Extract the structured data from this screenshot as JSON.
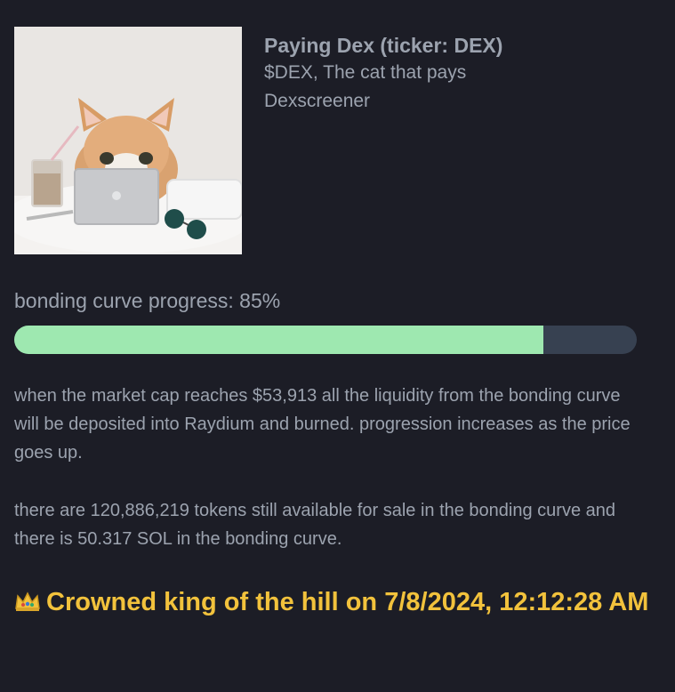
{
  "token": {
    "title": "Paying Dex (ticker: DEX)",
    "description": "$DEX, The cat that pays Dexscreener",
    "image_icon": "cat-with-laptop-image"
  },
  "progress": {
    "label": "bonding curve progress: 85%",
    "percent": 85,
    "fill_color": "#9ee8b0",
    "track_color": "#374151"
  },
  "info": {
    "paragraph1": "when the market cap reaches $53,913 all the liquidity from the bonding curve will be deposited into Raydium and burned. progression increases as the price goes up.",
    "paragraph2": "there are 120,886,219 tokens still available for sale in the bonding curve and there is 50.317 SOL in the bonding curve."
  },
  "king": {
    "icon": "crown-icon",
    "text": "Crowned king of the hill on 7/8/2024, 12:12:28 AM",
    "color": "#f2c23c"
  }
}
